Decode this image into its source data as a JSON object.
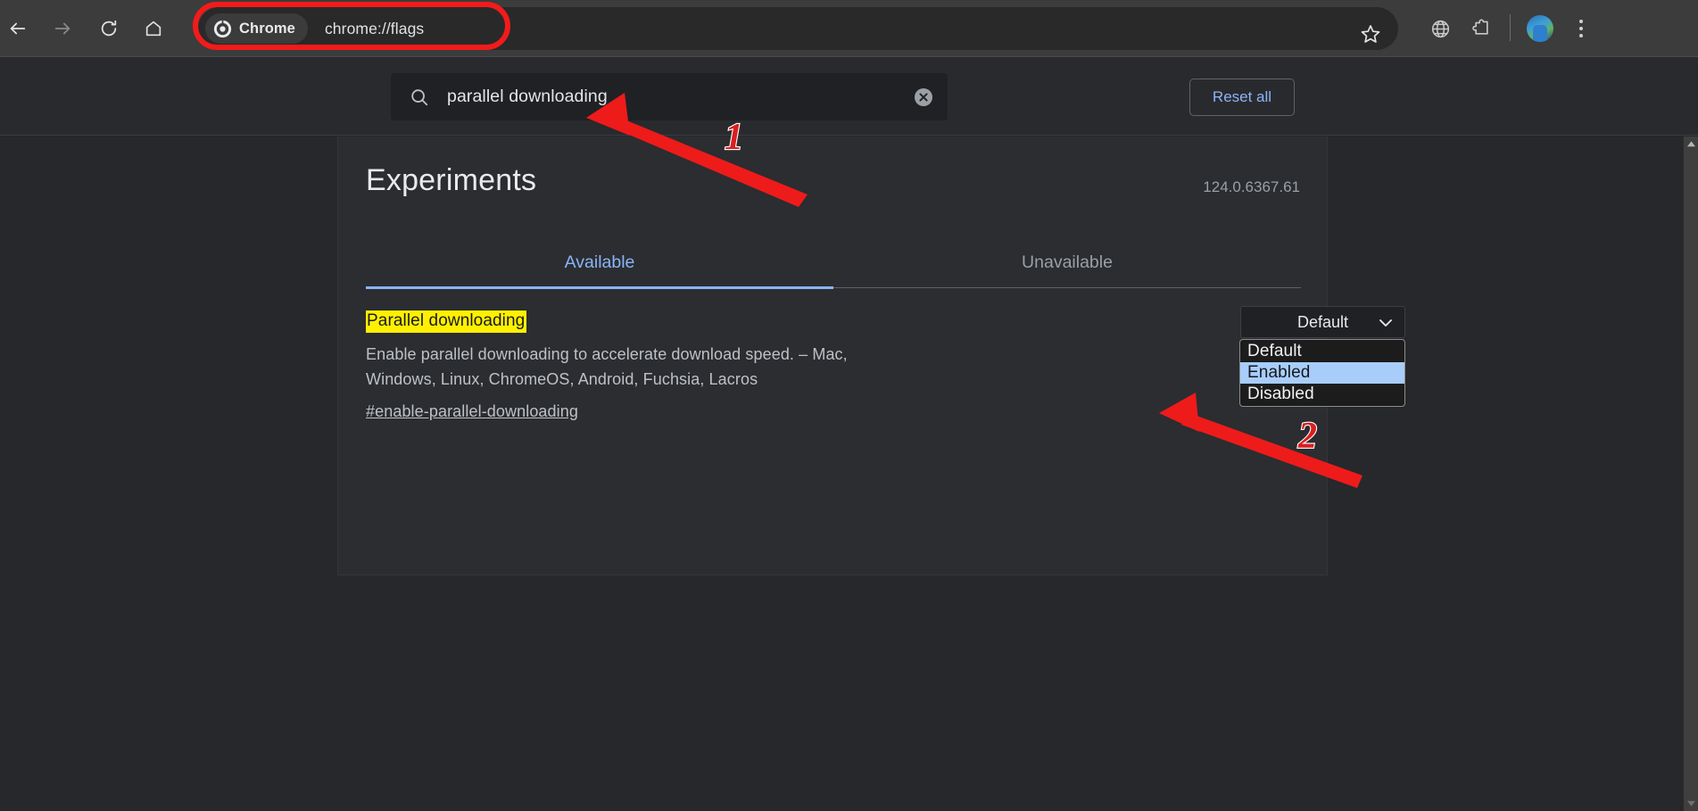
{
  "browser": {
    "nav": {
      "back_label": "Back",
      "forward_label": "Forward",
      "reload_label": "Reload",
      "home_label": "Home"
    },
    "omnibox": {
      "chip_label": "Chrome",
      "url": "chrome://flags",
      "bookmark_label": "Bookmark this tab"
    },
    "toolbar_icons": {
      "globe_label": "Translate",
      "extensions_label": "Extensions",
      "profile_label": "Profile",
      "menu_label": "Customize and control Google Chrome"
    }
  },
  "flags_toolbar": {
    "search": {
      "value": "parallel downloading",
      "placeholder": "Search flags",
      "clear_label": "Clear search"
    },
    "reset_all_label": "Reset all"
  },
  "content": {
    "title": "Experiments",
    "version": "124.0.6367.61",
    "tabs": [
      {
        "label": "Available",
        "selected": true
      },
      {
        "label": "Unavailable",
        "selected": false
      }
    ],
    "flag": {
      "title": "Parallel downloading",
      "description": "Enable parallel downloading to accelerate download speed. – Mac, Windows, Linux, ChromeOS, Android, Fuchsia, Lacros",
      "permalink": "#enable-parallel-downloading",
      "select": {
        "value": "Default",
        "options": [
          {
            "label": "Default",
            "highlighted": false
          },
          {
            "label": "Enabled",
            "highlighted": true
          },
          {
            "label": "Disabled",
            "highlighted": false
          }
        ]
      }
    }
  },
  "annotations": {
    "step_one": "1",
    "step_two": "2"
  },
  "colors": {
    "accent_blue": "#8ab4f8",
    "highlight_yellow": "#fff000",
    "annotation_red": "#f21b1b",
    "option_highlight": "#a8cdfa",
    "browser_chrome": "#3c3c3c",
    "page_background": "#26282b",
    "card_background": "#2b2d30"
  }
}
